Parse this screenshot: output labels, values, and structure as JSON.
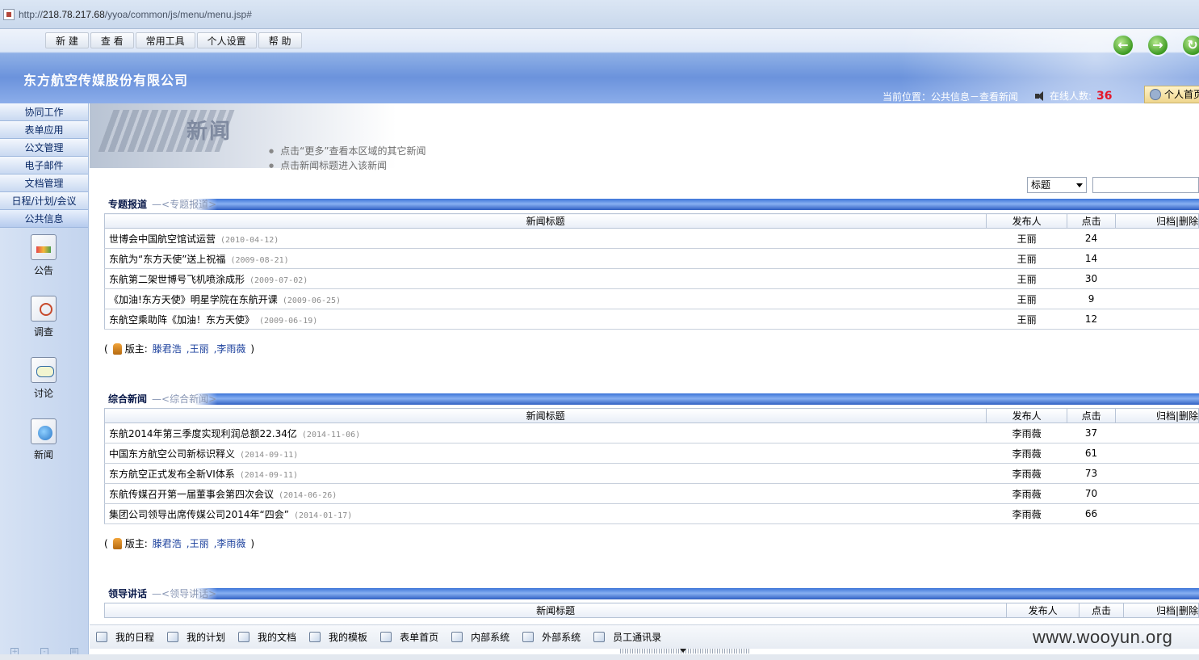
{
  "browser": {
    "url_prefix": "http://",
    "url_host": "218.78.217.68",
    "url_path": "/yyoa/common/js/menu/menu.jsp#"
  },
  "menu": [
    "新  建",
    "查  看",
    "常用工具",
    "个人设置",
    "帮  助"
  ],
  "nav_buttons": [
    "back-icon",
    "forward-icon",
    "refresh-icon"
  ],
  "company": "东方航空传媒股份有限公司",
  "location": "当前位置：公共信息－查看新闻",
  "online": {
    "label": "在线人数:",
    "count": "36"
  },
  "home_button": "个人首页",
  "sidebar": {
    "categories": [
      "协同工作",
      "表单应用",
      "公文管理",
      "电子邮件",
      "文档管理",
      "日程/计划/会议",
      "公共信息"
    ],
    "icons": [
      {
        "label": "公告",
        "icon": "announcement-icon"
      },
      {
        "label": "调查",
        "icon": "survey-icon"
      },
      {
        "label": "讨论",
        "icon": "discussion-icon"
      },
      {
        "label": "新闻",
        "icon": "news-icon"
      }
    ]
  },
  "banner_title": "新闻",
  "tips": [
    "点击“更多”查看本区域的其它新闻",
    "点击新闻标题进入该新闻"
  ],
  "search": {
    "field": "标题",
    "value": ""
  },
  "columns": {
    "title": "新闻标题",
    "publisher": "发布人",
    "clicks": "点击",
    "archive": "归档|删除"
  },
  "sections": [
    {
      "name": "专题报道",
      "sub": "—<专题报道>",
      "rows": [
        {
          "title": "世博会中国航空馆试运营",
          "date": "(2010-04-12)",
          "publisher": "王丽",
          "clicks": "24"
        },
        {
          "title": "东航为“东方天使”送上祝福",
          "date": "(2009-08-21)",
          "publisher": "王丽",
          "clicks": "14"
        },
        {
          "title": "东航第二架世博号飞机喷涂成形",
          "date": "(2009-07-02)",
          "publisher": "王丽",
          "clicks": "30"
        },
        {
          "title": "《加油!东方天使》明星学院在东航开课",
          "date": "(2009-06-25)",
          "publisher": "王丽",
          "clicks": "9"
        },
        {
          "title": "东航空乘助阵《加油！东方天使》",
          "date": "(2009-06-19)",
          "publisher": "王丽",
          "clicks": "12"
        }
      ],
      "editors_label": "版主:",
      "editors": [
        "滕君浩",
        ",王丽",
        ",李雨薇"
      ]
    },
    {
      "name": "综合新闻",
      "sub": "—<综合新闻>",
      "rows": [
        {
          "title": "东航2014年第三季度实现利润总额22.34亿",
          "date": "(2014-11-06)",
          "publisher": "李雨薇",
          "clicks": "37"
        },
        {
          "title": "中国东方航空公司新标识释义",
          "date": "(2014-09-11)",
          "publisher": "李雨薇",
          "clicks": "61"
        },
        {
          "title": "东方航空正式发布全新VI体系",
          "date": "(2014-09-11)",
          "publisher": "李雨薇",
          "clicks": "73"
        },
        {
          "title": "东航传媒召开第一届董事会第四次会议",
          "date": "(2014-06-26)",
          "publisher": "李雨薇",
          "clicks": "70"
        },
        {
          "title": "集团公司领导出席传媒公司2014年“四会”",
          "date": "(2014-01-17)",
          "publisher": "李雨薇",
          "clicks": "66"
        }
      ],
      "editors_label": "版主:",
      "editors": [
        "滕君浩",
        ",王丽",
        ",李雨薇"
      ]
    },
    {
      "name": "领导讲话",
      "sub": "—<领导讲话>",
      "rows": []
    }
  ],
  "bottom_toolbar": [
    "我的日程",
    "我的计划",
    "我的文档",
    "我的模板",
    "表单首页",
    "内部系统",
    "外部系统",
    "员工通讯录"
  ],
  "watermark": "www.wooyun.org"
}
